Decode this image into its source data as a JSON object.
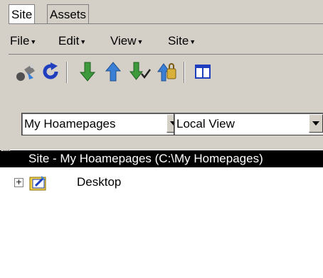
{
  "tabs": [
    {
      "label": "Site"
    },
    {
      "label": "Assets"
    }
  ],
  "menu": [
    {
      "label": "File"
    },
    {
      "label": "Edit"
    },
    {
      "label": "View"
    },
    {
      "label": "Site"
    }
  ],
  "toolbar": {
    "buttons": [
      {
        "icon": "connect-icon"
      },
      {
        "icon": "refresh-icon"
      },
      {
        "icon": "get-files-icon"
      },
      {
        "icon": "put-files-icon"
      },
      {
        "icon": "check-out-icon"
      },
      {
        "icon": "check-in-icon"
      },
      {
        "icon": "expand-panel-icon"
      }
    ]
  },
  "site_select": {
    "value": "My Hoamepages"
  },
  "view_select": {
    "value": "Local View"
  },
  "site_root": {
    "label": "Site - My Hoamepages (C:\\My Homepages)"
  },
  "tree": [
    {
      "label": "Desktop",
      "expander": "+"
    }
  ],
  "colors": {
    "chrome": "#d4d0c8",
    "selection": "#000000",
    "refresh_blue": "#1f3fbf",
    "arrow_green": "#3c9a3c",
    "arrow_blue": "#3a7fd6"
  }
}
